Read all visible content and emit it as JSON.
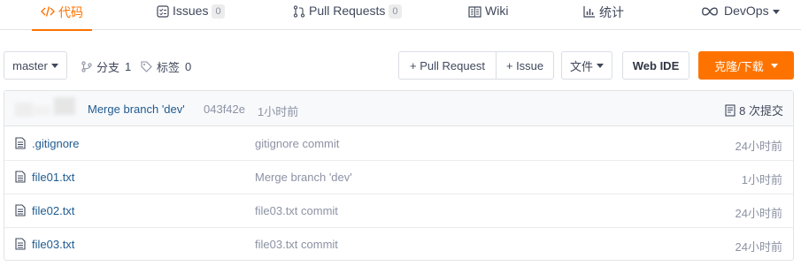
{
  "tabs": [
    {
      "label": "代码",
      "icon": "code-icon",
      "active": true
    },
    {
      "label": "Issues",
      "icon": "issues-icon",
      "badge": "0"
    },
    {
      "label": "Pull Requests",
      "icon": "pull-request-icon",
      "badge": "0"
    },
    {
      "label": "Wiki",
      "icon": "wiki-icon"
    },
    {
      "label": "统计",
      "icon": "stats-icon"
    },
    {
      "label": "DevOps",
      "icon": "infinity-icon"
    }
  ],
  "toolbar": {
    "branch": "master",
    "branches_label": "分支",
    "branches_count": "1",
    "tags_label": "标签",
    "tags_count": "0",
    "new_pr": "+ Pull Request",
    "new_issue": "+ Issue",
    "files": "文件",
    "web_ide": "Web IDE",
    "clone": "克隆/下载"
  },
  "commit": {
    "message": "Merge branch 'dev'",
    "sha": "043f42e",
    "time": "1小时前",
    "count_label": "8 次提交"
  },
  "files": [
    {
      "name": ".gitignore",
      "message": "gitignore commit",
      "time": "24小时前"
    },
    {
      "name": "file01.txt",
      "message": "Merge branch 'dev'",
      "time": "1小时前"
    },
    {
      "name": "file02.txt",
      "message": "file03.txt commit",
      "time": "24小时前"
    },
    {
      "name": "file03.txt",
      "message": "file03.txt commit",
      "time": "24小时前"
    }
  ],
  "colors": {
    "accent": "#fe7300",
    "link": "#1f5b8f",
    "muted": "#8c92a4"
  }
}
